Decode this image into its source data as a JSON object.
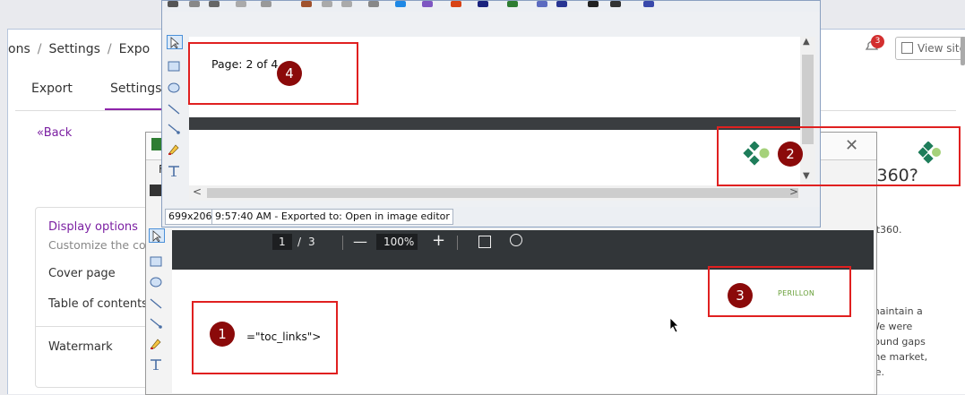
{
  "app": {
    "breadcrumb": [
      "ons",
      "Settings",
      "Expo"
    ],
    "breadcrumb_sep": "/",
    "notification_count": "3",
    "view_site": "View site",
    "tabs": [
      "Export",
      "Settings"
    ],
    "back_link": "«Back",
    "display_options": {
      "title": "Display options",
      "subtitle": "Customize the cov",
      "options": [
        "Cover page",
        "Table of contents",
        "Watermark"
      ]
    },
    "right_heading": "nt360?",
    "right_line": "ent360.",
    "right_paragraph": [
      "maintain a",
      "We were",
      "round gaps",
      "the market,",
      "se."
    ],
    "accent_color": "#8e24aa"
  },
  "background_window": {
    "menu_letter": "F"
  },
  "editor": {
    "page_label": "Page: 2 of 4",
    "status_size": "699x206",
    "status_message": "9:57:40 AM - Exported to: Open in image editor"
  },
  "pdf_viewer": {
    "current_page": "1",
    "page_sep": "/",
    "total_pages": "3",
    "zoom": "100%",
    "toc_text": "=\"toc_links\">",
    "logo_text": "PERILLON"
  },
  "callouts": [
    "1",
    "2",
    "3",
    "4"
  ],
  "annotation_color": "#e02020",
  "icons": [
    "bell-icon",
    "external-link-icon",
    "close-icon",
    "pointer-icon",
    "rectangle-icon",
    "ellipse-icon",
    "line-icon",
    "arrow-icon",
    "highlighter-icon",
    "text-tool-icon",
    "save-icon",
    "fit-page-icon",
    "rotate-icon",
    "mouse-cursor-icon"
  ]
}
